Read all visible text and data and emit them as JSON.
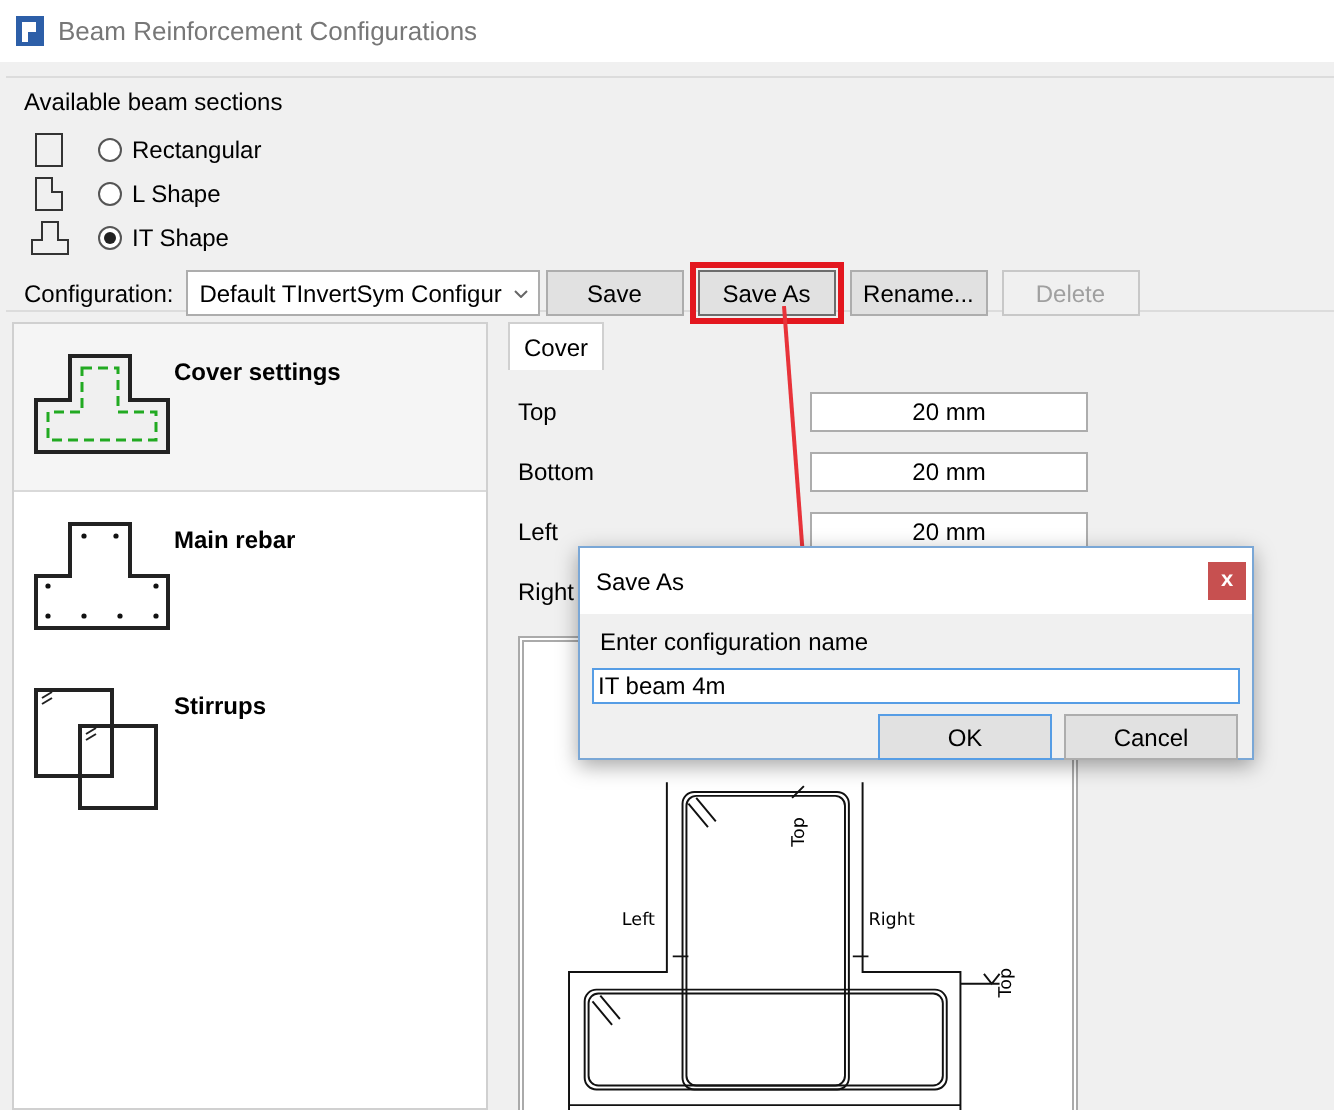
{
  "window": {
    "title": "Beam Reinforcement Configurations"
  },
  "sections": {
    "label": "Available beam sections",
    "options": [
      {
        "label": "Rectangular",
        "kind": "rect",
        "selected": false
      },
      {
        "label": "L Shape",
        "kind": "l",
        "selected": false
      },
      {
        "label": "IT Shape",
        "kind": "it",
        "selected": true
      }
    ]
  },
  "configuration": {
    "label": "Configuration:",
    "value": "Default TInvertSym Configur"
  },
  "buttons": [
    {
      "label": "Save",
      "disabled": false,
      "highlighted": false
    },
    {
      "label": "Save As",
      "disabled": false,
      "highlighted": true
    },
    {
      "label": "Rename...",
      "disabled": false,
      "highlighted": false
    },
    {
      "label": "Delete",
      "disabled": true,
      "highlighted": false
    }
  ],
  "categories": [
    {
      "label": "Cover settings",
      "kind": "cover",
      "selected": true
    },
    {
      "label": "Main rebar",
      "kind": "rebar",
      "selected": false
    },
    {
      "label": "Stirrups",
      "kind": "stirrups",
      "selected": false
    }
  ],
  "tabs": [
    {
      "label": "Cover",
      "selected": true
    }
  ],
  "cover_fields": [
    {
      "label": "Top",
      "value": "20 mm"
    },
    {
      "label": "Bottom",
      "value": "20 mm"
    },
    {
      "label": "Left",
      "value": "20 mm"
    },
    {
      "label": "Right"
    }
  ],
  "drawing": {
    "labels": [
      "Top",
      "Left",
      "Right",
      "Top"
    ]
  },
  "dialog": {
    "title": "Save As",
    "close": "x",
    "prompt": "Enter configuration name",
    "value": "IT beam 4m",
    "buttons": [
      {
        "label": "OK",
        "default": true
      },
      {
        "label": "Cancel",
        "default": false
      }
    ]
  }
}
